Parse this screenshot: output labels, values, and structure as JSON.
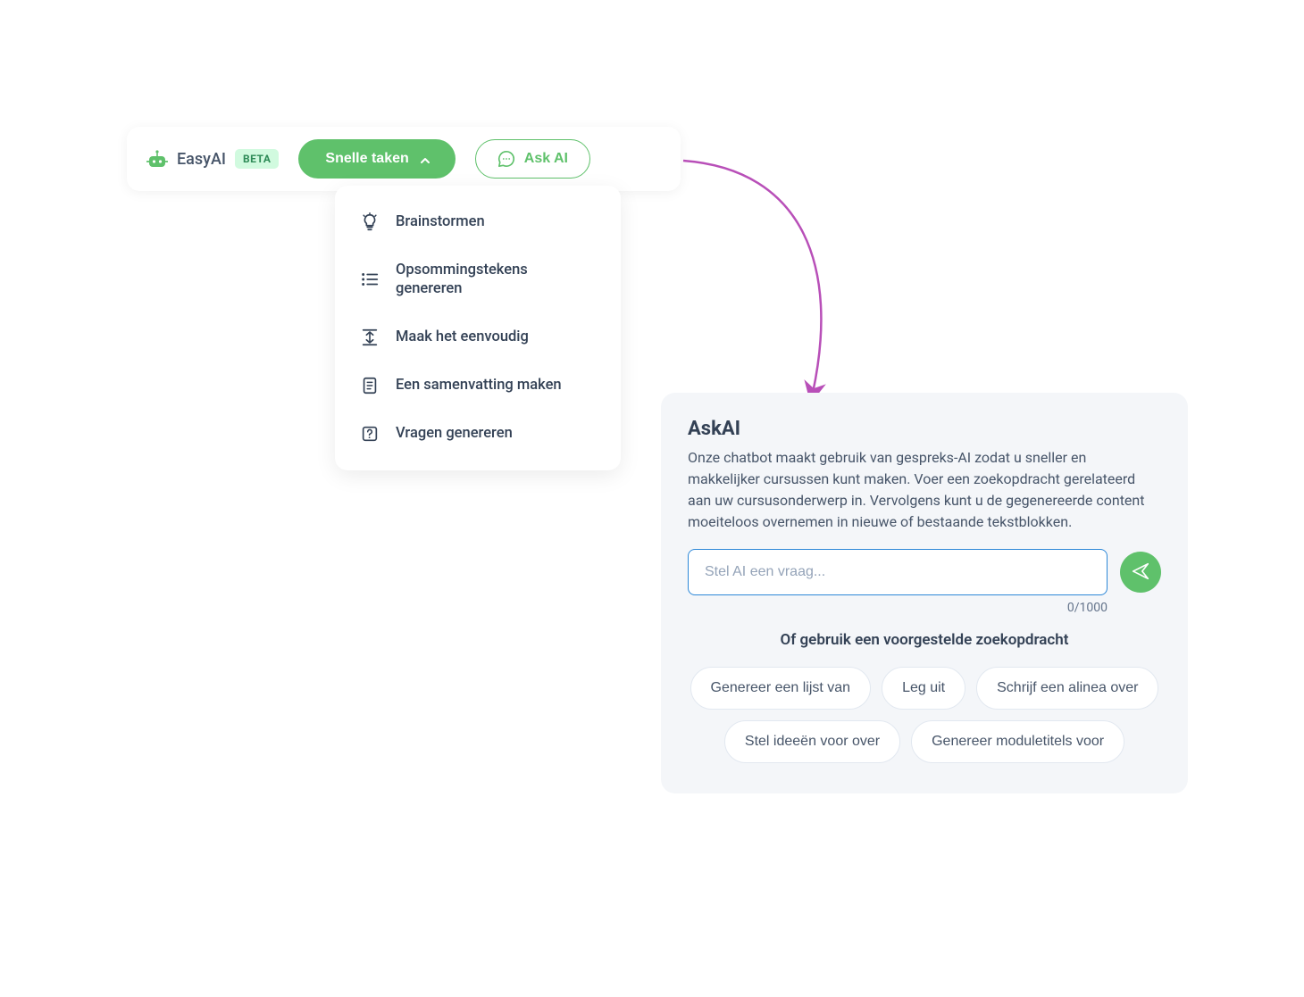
{
  "toolbar": {
    "brand_name": "EasyAI",
    "beta_label": "BETA",
    "quick_tasks_label": "Snelle taken",
    "ask_ai_label": "Ask AI"
  },
  "dropdown": {
    "items": [
      {
        "icon": "lightbulb-icon",
        "label": "Brainstormen"
      },
      {
        "icon": "bullet-list-icon",
        "label": "Opsommingstekens genereren"
      },
      {
        "icon": "simplify-icon",
        "label": "Maak het eenvoudig"
      },
      {
        "icon": "summary-icon",
        "label": "Een samenvatting maken"
      },
      {
        "icon": "question-icon",
        "label": "Vragen genereren"
      }
    ]
  },
  "panel": {
    "title": "AskAI",
    "description": "Onze chatbot maakt gebruik van gespreks-AI zodat u sneller en makkelijker cursussen kunt maken. Voer een zoekopdracht gerelateerd aan uw cursusonderwerp in. Vervolgens kunt u de gegenereerde content moeiteloos overnemen in nieuwe of bestaande tekstblokken.",
    "input_placeholder": "Stel AI een vraag...",
    "input_value": "",
    "char_counter": "0/1000",
    "suggest_heading": "Of gebruik een voorgestelde zoekopdracht",
    "suggestions": [
      "Genereer een lijst van",
      "Leg uit",
      "Schrijf een alinea over",
      "Stel ideeën voor over",
      "Genereer moduletitels voor"
    ]
  },
  "colors": {
    "accent_green": "#5fc16b",
    "accent_blue": "#2d88d8",
    "arrow_pink": "#b84fb8"
  }
}
